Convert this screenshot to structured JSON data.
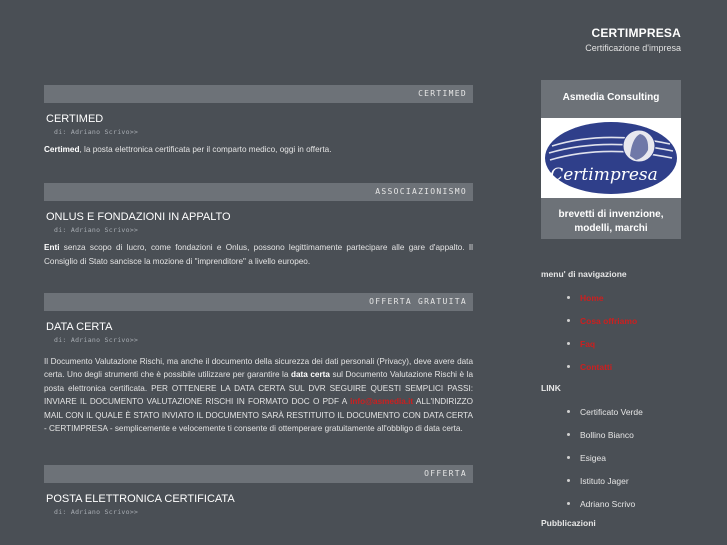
{
  "header": {
    "title": "CERTIMPRESA",
    "tagline": "Certificazione d'impresa"
  },
  "posts": [
    {
      "category": "CERTIMED",
      "title": "CERTIMED",
      "author": "di: Adriano Scrivo>>",
      "bold": "Certimed",
      "body": ", la posta elettronica certificata per il comparto medico, oggi in offerta."
    },
    {
      "category": "ASSOCIAZIONISMO",
      "title": "ONLUS E FONDAZIONI IN APPALTO",
      "author": "di: Adriano Scrivo>>",
      "bold": "Enti",
      "body": " senza scopo di lucro, come fondazioni e Onlus, possono legittimamente partecipare alle gare d'appalto. Il Consiglio di Stato sancisce la mozione di \"imprenditore\" a livello europeo."
    },
    {
      "category": "OFFERTA GRATUITA",
      "title": "DATA CERTA",
      "author": "di: Adriano Scrivo>>",
      "body_a": "Il Documento Valutazione Rischi, ma anche il documento della sicurezza dei dati personali (Privacy), deve avere data certa. Uno degli strumenti che è possibile utilizzare per garantire la ",
      "bold": "data certa",
      "body_b": " sul Documento Valutazione Rischi è la posta elettronica certificata. PER OTTENERE LA DATA CERTA SUL DVR SEGUIRE QUESTI SEMPLICI PASSI: INVIARE IL DOCUMENTO VALUTAZIONE RISCHI IN FORMATO DOC O PDF A ",
      "link": "info@asmedia.it",
      "body_c": " ALL'INDIRIZZO MAIL CON IL QUALE È STATO INVIATO IL DOCUMENTO SARÀ RESTITUITO IL DOCUMENTO CON DATA CERTA - CERTIMPRESA - semplicemente e velocemente ti consente di ottemperare gratuitamente all'obbligo di data certa."
    },
    {
      "category": "OFFERTA",
      "title": "POSTA ELETTRONICA CERTIFICATA",
      "author": "di: Adriano Scrivo>>"
    }
  ],
  "sidebar": {
    "ad_title": "Asmedia Consulting",
    "logo_text": "Certimpresa",
    "ad_sub": "brevetti di invenzione, modelli, marchi",
    "nav_heading": "menu' di navigazione",
    "nav_items": [
      "Home",
      "Cosa offriamo",
      "Faq",
      "Contatti"
    ],
    "link_heading": "LINK",
    "link_items": [
      "Certificato Verde",
      "Bollino Bianco",
      "Esigea",
      "Istituto Jager",
      "Adriano Scrivo"
    ],
    "pub_heading": "Pubblicazioni"
  },
  "colors": {
    "background": "#4a4f55",
    "bar": "#6d7278",
    "accent_red": "#cc1f1f",
    "logo_blue": "#2f3f8a"
  }
}
